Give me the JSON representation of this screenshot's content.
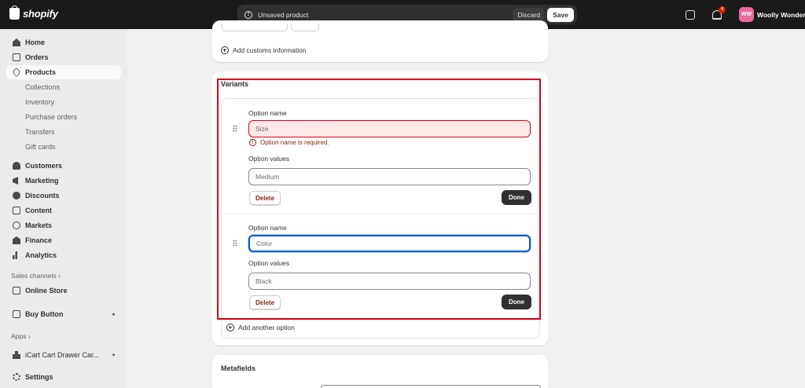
{
  "topbar": {
    "logo_text": "shopify",
    "unsaved_text": "Unsaved product",
    "discard_label": "Discard",
    "save_label": "Save",
    "notification_count": "4",
    "avatar_initials": "WW",
    "store_name": "Woolly Wonders"
  },
  "sidebar": {
    "items": [
      {
        "label": "Home",
        "icon": "home-icon"
      },
      {
        "label": "Orders",
        "icon": "orders-icon"
      },
      {
        "label": "Products",
        "icon": "tag-icon",
        "active": true
      },
      {
        "label": "Customers",
        "icon": "person-icon"
      },
      {
        "label": "Marketing",
        "icon": "megaphone-icon"
      },
      {
        "label": "Discounts",
        "icon": "discount-icon"
      },
      {
        "label": "Content",
        "icon": "content-icon"
      },
      {
        "label": "Markets",
        "icon": "globe-icon"
      },
      {
        "label": "Finance",
        "icon": "bank-icon"
      },
      {
        "label": "Analytics",
        "icon": "bar-chart-icon"
      }
    ],
    "product_subitems": [
      "Collections",
      "Inventory",
      "Purchase orders",
      "Transfers",
      "Gift cards"
    ],
    "sales_channels_label": "Sales channels",
    "online_store_label": "Online Store",
    "buy_button_label": "Buy Button",
    "apps_label": "Apps",
    "app_item_label": "iCart Cart Drawer Car...",
    "settings_label": "Settings"
  },
  "main": {
    "add_customs_label": "Add customs information",
    "variants": {
      "title": "Variants",
      "options": [
        {
          "name_label": "Option name",
          "name_placeholder": "Size",
          "error": "Option name is required.",
          "values_label": "Option values",
          "value": "Medium",
          "delete_label": "Delete",
          "done_label": "Done"
        },
        {
          "name_label": "Option name",
          "name_placeholder": "Color",
          "values_label": "Option values",
          "value": "Black",
          "delete_label": "Delete",
          "done_label": "Done"
        }
      ],
      "add_option_label": "Add another option"
    },
    "metafields_title": "Metafields"
  },
  "colors": {
    "topbar_bg": "#1a1a1a",
    "error": "#d9001b",
    "focus": "#005bd3",
    "avatar": "#e86a9f"
  }
}
